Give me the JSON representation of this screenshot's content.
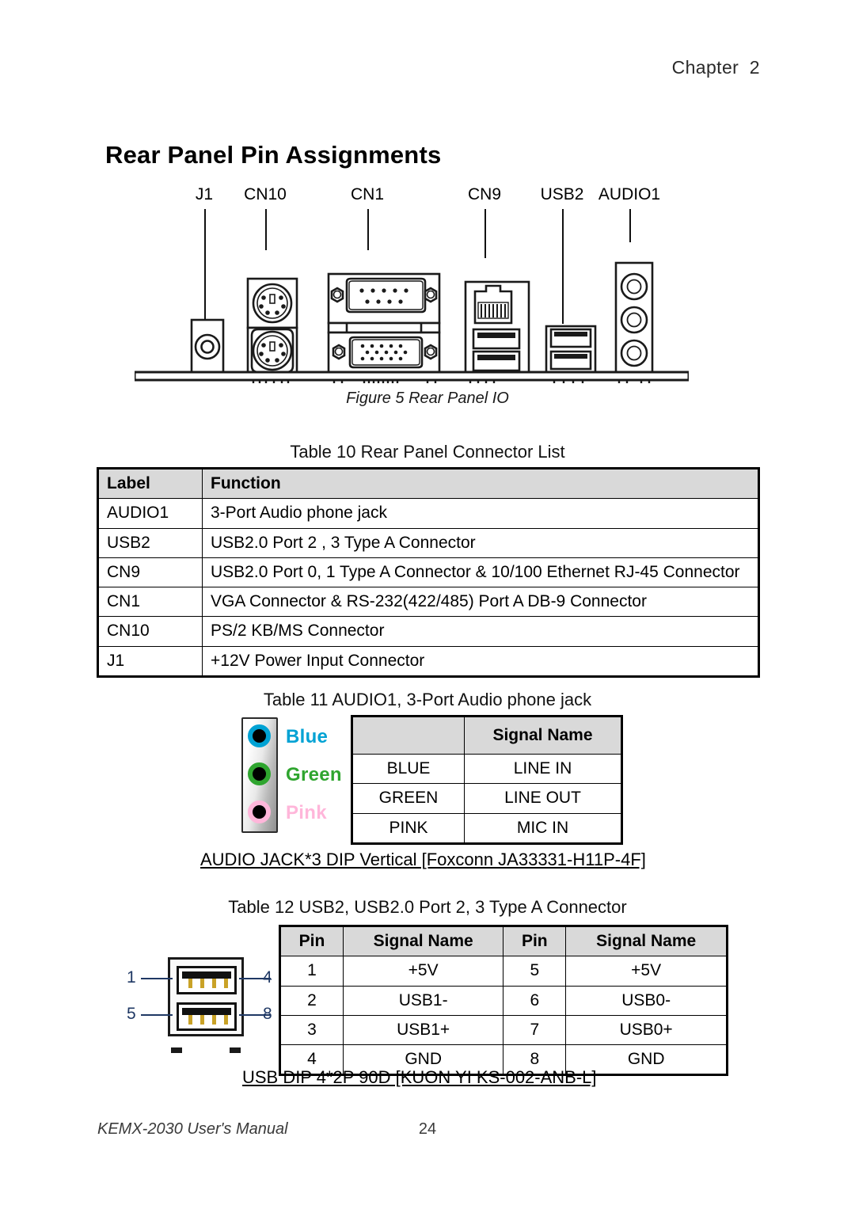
{
  "header": {
    "chapter": "Chapter  2"
  },
  "title": "Rear Panel Pin Assignments",
  "figure": {
    "caption": "Figure 5 Rear Panel IO",
    "connector_labels": [
      "J1",
      "CN10",
      "CN1",
      "CN9",
      "USB2",
      "AUDIO1"
    ]
  },
  "table10": {
    "caption": "Table 10 Rear Panel Connector List",
    "headers": [
      "Label",
      "Function"
    ],
    "rows": [
      [
        "AUDIO1",
        "3-Port Audio phone jack"
      ],
      [
        "USB2",
        "USB2.0 Port 2 , 3 Type A Connector"
      ],
      [
        "CN9",
        "USB2.0 Port 0, 1 Type A Connector & 10/100 Ethernet RJ-45 Connector"
      ],
      [
        "CN1",
        "VGA Connector & RS-232(422/485) Port A DB-9 Connector"
      ],
      [
        "CN10",
        "PS/2 KB/MS Connector"
      ],
      [
        "J1",
        "+12V Power Input Connector"
      ]
    ]
  },
  "table11": {
    "caption": "Table 11 AUDIO1, 3-Port Audio phone jack",
    "headers": [
      "",
      "Signal Name"
    ],
    "rows": [
      [
        "BLUE",
        "LINE IN"
      ],
      [
        "GREEN",
        "LINE OUT"
      ],
      [
        "PINK",
        "MIC IN"
      ]
    ],
    "part_note": "AUDIO JACK*3 DIP Vertical [Foxconn JA33331-H11P-4F]",
    "jacks": [
      {
        "label": "Blue",
        "color": "#00A2D4"
      },
      {
        "label": "Green",
        "color": "#2FA52F"
      },
      {
        "label": "Pink",
        "color": "#FFB6DA"
      }
    ]
  },
  "table12": {
    "caption": "Table 12 USB2, USB2.0 Port 2, 3 Type A Connector",
    "headers": [
      "Pin",
      "Signal Name",
      "Pin",
      "Signal Name"
    ],
    "rows": [
      [
        "1",
        "+5V",
        "5",
        "+5V"
      ],
      [
        "2",
        "USB1-",
        "6",
        "USB0-"
      ],
      [
        "3",
        "USB1+",
        "7",
        "USB0+"
      ],
      [
        "4",
        "GND",
        "8",
        "GND"
      ]
    ],
    "part_note": "USB DIP 4*2P 90D [KUON YI KS-002-ANB-L]",
    "pin_callouts": {
      "top_left": "1",
      "top_right": "4",
      "bottom_left": "5",
      "bottom_right": "8"
    }
  },
  "footer": {
    "manual": "KEMX-2030 User's Manual",
    "page": "24"
  }
}
